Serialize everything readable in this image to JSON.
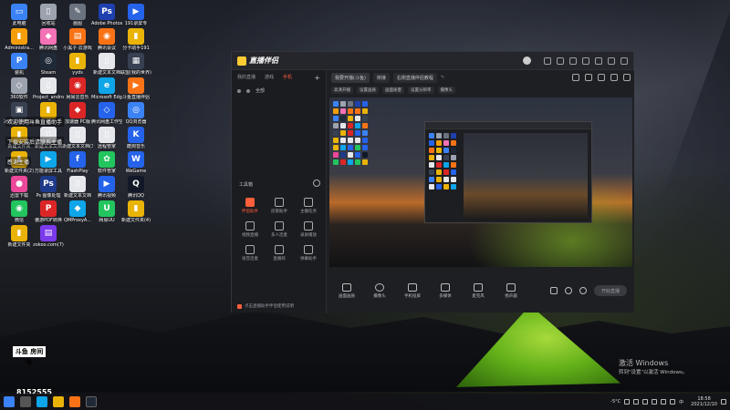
{
  "desktop": {
    "icons": [
      {
        "label": "此电脑",
        "color": "#3b82f6",
        "glyph": "▭"
      },
      {
        "label": "回收站",
        "color": "#9ca3af",
        "glyph": "▯"
      },
      {
        "label": "画图",
        "color": "#6b7280",
        "glyph": "✎"
      },
      {
        "label": "Adobe Photosh...",
        "color": "#1e40af",
        "glyph": "Ps"
      },
      {
        "label": "191录屏专",
        "color": "#2563eb",
        "glyph": "▶"
      },
      {
        "label": "Administra...",
        "color": "#f59e0b",
        "glyph": "▮"
      },
      {
        "label": "腾讯网盘",
        "color": "#f472b6",
        "glyph": "◆"
      },
      {
        "label": "小黑子·云游戏",
        "color": "#f97316",
        "glyph": "▤"
      },
      {
        "label": "腾讯会议",
        "color": "#f97316",
        "glyph": "◉"
      },
      {
        "label": "分卡助手191",
        "color": "#eab308",
        "glyph": "▮"
      },
      {
        "label": "装机",
        "color": "#3b82f6",
        "glyph": "P"
      },
      {
        "label": "Steam",
        "color": "#1f2937",
        "glyph": "◎"
      },
      {
        "label": "yyds",
        "color": "#eab308",
        "glyph": "▮"
      },
      {
        "label": "新建文本文档",
        "color": "#e5e7eb",
        "glyph": "▯"
      },
      {
        "label": "联盟(我的世界)",
        "color": "#374151",
        "glyph": "▦"
      },
      {
        "label": "360软件",
        "color": "#9ca3af",
        "glyph": "◇"
      },
      {
        "label": "Project_android",
        "color": "#e5e7eb",
        "glyph": "▯"
      },
      {
        "label": "网易云音乐",
        "color": "#dc2626",
        "glyph": "◉"
      },
      {
        "label": "Microsoft Edge",
        "color": "#0ea5e9",
        "glyph": "e"
      },
      {
        "label": "斗鱼直播伴侣",
        "color": "#f97316",
        "glyph": "▶"
      },
      {
        "label": "冰与火之歌 Dance of F...",
        "color": "#374151",
        "glyph": "▣"
      },
      {
        "label": "rj",
        "color": "#eab308",
        "glyph": "▮"
      },
      {
        "label": "加速器 PC版",
        "color": "#dc2626",
        "glyph": "◆"
      },
      {
        "label": "腾讯网盘工作空间",
        "color": "#2563eb",
        "glyph": "◇"
      },
      {
        "label": "QQ浏览器",
        "color": "#3b82f6",
        "glyph": "◎"
      },
      {
        "label": "新建文件夹",
        "color": "#eab308",
        "glyph": "▮"
      },
      {
        "label": "新建文本文档",
        "color": "#e5e7eb",
        "glyph": "▯"
      },
      {
        "label": "新建文本文档(3)",
        "color": "#e5e7eb",
        "glyph": "▯"
      },
      {
        "label": "远程管家",
        "color": "#e5e7eb",
        "glyph": "▯"
      },
      {
        "label": "酷狗音乐",
        "color": "#2563eb",
        "glyph": "K"
      },
      {
        "label": "新建文件夹(2)",
        "color": "#eab308",
        "glyph": "▮"
      },
      {
        "label": "万能录屏工具",
        "color": "#0ea5e9",
        "glyph": "▶"
      },
      {
        "label": "FlashPlay",
        "color": "#2563eb",
        "glyph": "f"
      },
      {
        "label": "软件管家",
        "color": "#22c55e",
        "glyph": "✿"
      },
      {
        "label": "WeGame",
        "color": "#2563eb",
        "glyph": "W"
      },
      {
        "label": "迅雷下载",
        "color": "#ec4899",
        "glyph": "●"
      },
      {
        "label": "Ps 图像处理",
        "color": "#1e3a8a",
        "glyph": "Ps"
      },
      {
        "label": "新建文本文档",
        "color": "#e5e7eb",
        "glyph": "▯"
      },
      {
        "label": "腾讯视频",
        "color": "#2563eb",
        "glyph": "▶"
      },
      {
        "label": "腾讯QQ",
        "color": "#111827",
        "glyph": "Q"
      },
      {
        "label": "微信",
        "color": "#22c55e",
        "glyph": "◉"
      },
      {
        "label": "傲游PDF转换",
        "color": "#dc2626",
        "glyph": "P"
      },
      {
        "label": "QMProxyA...",
        "color": "#0ea5e9",
        "glyph": "◆"
      },
      {
        "label": "网易UU",
        "color": "#22c55e",
        "glyph": "U"
      },
      {
        "label": "新建文件夹(4)",
        "color": "#eab308",
        "glyph": "▮"
      },
      {
        "label": "新建文件夹",
        "color": "#eab308",
        "glyph": "▮"
      },
      {
        "label": "zokoo.com(7)",
        "color": "#7c3aed",
        "glyph": "▤"
      }
    ],
    "overlay_texts": [
      "欢迎使用斗鱼直播助手",
      "下载安装后请联系主播",
      "感谢主播"
    ],
    "douyu": {
      "logo_text": "斗鱼 房间号",
      "room_id": "8152555"
    },
    "watermark": {
      "line1": "激活 Windows",
      "line2": "转到\"设置\"以激活 Windows。"
    }
  },
  "app": {
    "title": "直播伴侣",
    "side_tabs": [
      "我的直播",
      "游戏",
      "手机"
    ],
    "active_side_tab": "手机",
    "scene_name": "全部",
    "tools_title": "工具箱",
    "tools": [
      {
        "label": "伴侣助手",
        "hot": true
      },
      {
        "label": "房管助手",
        "hot": false
      },
      {
        "label": "主播任务",
        "hot": false
      },
      {
        "label": "视频直播",
        "hot": false
      },
      {
        "label": "多人连麦",
        "hot": false
      },
      {
        "label": "录屏播放",
        "hot": false
      },
      {
        "label": "语音连麦",
        "hot": false
      },
      {
        "label": "直播商",
        "hot": false
      },
      {
        "label": "弹幕助手",
        "hot": false
      }
    ],
    "side_footer": "点击直播助手伴侣使用说明",
    "main_tabs": [
      {
        "label": "我要开播(斗鱼)",
        "active": true
      },
      {
        "label": "桥接"
      },
      {
        "label": "右侧直播伴侣教程",
        "active": false
      }
    ],
    "sub_chips": [
      "高清开播",
      "设置画质",
      "画面质量",
      "设置分辨率",
      "摄像头"
    ],
    "controls": [
      {
        "label": "画面画质"
      },
      {
        "label": "摄像头"
      },
      {
        "label": "手机投屏"
      },
      {
        "label": "多媒体"
      },
      {
        "label": "麦克风"
      },
      {
        "label": "扬声器"
      }
    ],
    "live_button": "开始直播"
  },
  "taskbar": {
    "weather": "-5°C",
    "lang": "中",
    "time": "18:58",
    "date": "2021/12/10"
  }
}
